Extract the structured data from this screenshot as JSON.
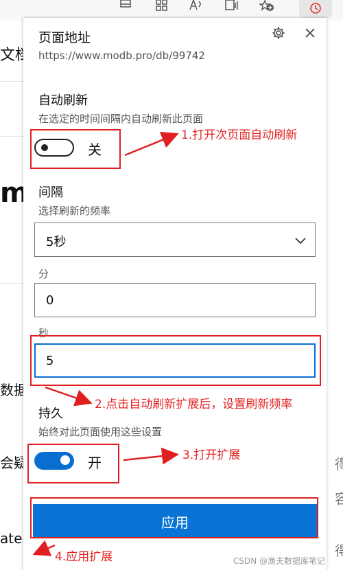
{
  "panel": {
    "title": "页面地址",
    "url": "https://www.modb.pro/db/99742",
    "settings_icon": "gear-icon",
    "close_icon": "close-icon",
    "auto_refresh": {
      "heading": "自动刷新",
      "description": "在选定的时间间隔内自动刷新此页面",
      "state_label": "关",
      "enabled": false
    },
    "interval": {
      "heading": "间隔",
      "description": "选择刷新的频率",
      "selected": "5秒",
      "minutes_label": "分",
      "minutes_value": "0",
      "seconds_label": "秒",
      "seconds_value": "5"
    },
    "persist": {
      "heading": "持久",
      "description": "始终对此页面使用这些设置",
      "state_label": "开",
      "enabled": true
    },
    "apply_label": "应用"
  },
  "background": {
    "left_texts": [
      "文档",
      "m",
      "数据",
      "会疑",
      "ate"
    ],
    "right_texts": [
      "得",
      "容",
      "得"
    ]
  },
  "annotations": [
    "1.打开次页面自动刷新",
    "2.点击自动刷新扩展后，设置刷新频率",
    "3.打开扩展",
    "4.应用扩展"
  ],
  "watermark": "CSDN @渔夫数据库笔记",
  "colors": {
    "accent": "#0a74d6",
    "annotation": "#e02020"
  }
}
